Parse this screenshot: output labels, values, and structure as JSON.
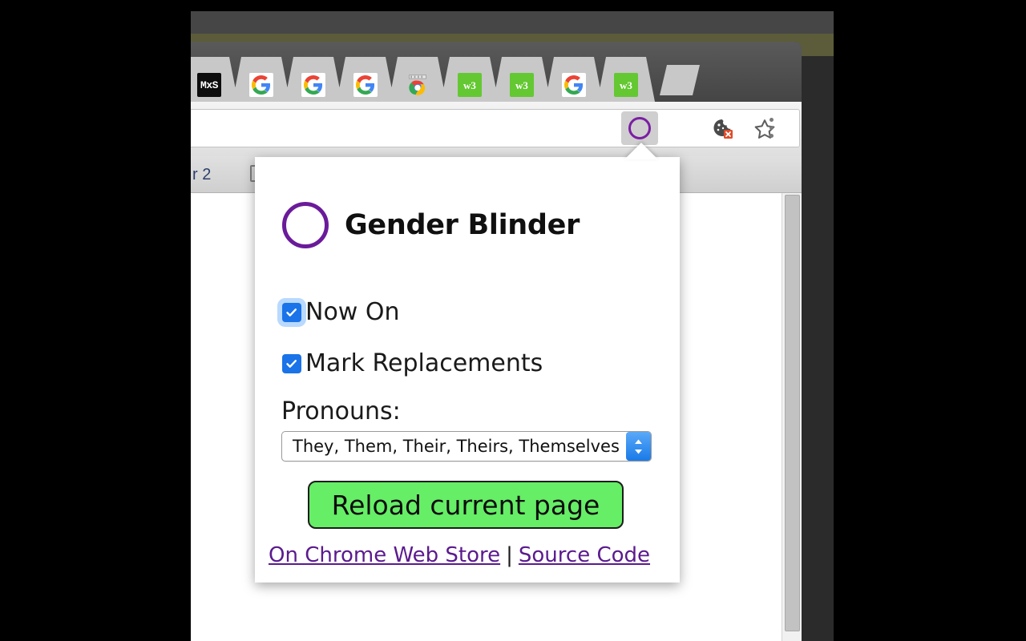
{
  "window": {
    "browser": "Chrome",
    "tabs": [
      {
        "favicon": "mxs-favicon",
        "label": "MxS"
      },
      {
        "favicon": "google-favicon",
        "label": "G"
      },
      {
        "favicon": "google-favicon",
        "label": "G"
      },
      {
        "favicon": "google-favicon",
        "label": "G"
      },
      {
        "favicon": "chrome-web-store-favicon",
        "label": ""
      },
      {
        "favicon": "w3schools-favicon",
        "label": "w3"
      },
      {
        "favicon": "w3schools-favicon",
        "label": "w3"
      },
      {
        "favicon": "google-favicon",
        "label": "G"
      },
      {
        "favicon": "w3schools-favicon",
        "label": "w3"
      }
    ],
    "new_tab_button": "new-tab-button"
  },
  "toolbar": {
    "cookie_blocked_icon": "cookie-blocked-icon",
    "bookmark_star_icon": "star-icon",
    "extension_icon": "gender-blinder-extension-icon",
    "drive_icon": "google-drive-icon",
    "menu_icon": "three-dot-menu-icon"
  },
  "bookmark_bar": {
    "visible_text": "r 2",
    "folder_icon": "folder-icon"
  },
  "popup": {
    "logo_icon": "purple-circle-logo",
    "title": "Gender Blinder",
    "checkboxes": [
      {
        "label": "Now On",
        "checked": true,
        "focused": true
      },
      {
        "label": "Mark Replacements",
        "checked": true,
        "focused": false
      }
    ],
    "pronouns_label": "Pronouns:",
    "pronouns_selected": "They, Them, Their, Theirs, Themselves",
    "reload_button": "Reload current page",
    "links": [
      {
        "text": "On Chrome Web Store "
      },
      {
        "text": "Source Code"
      }
    ],
    "link_separator": "|"
  },
  "colors": {
    "accent_purple": "#6A1B9A",
    "link_purple": "#5b1a8e",
    "button_green": "#66ee66",
    "checkbox_blue": "#1a73e8",
    "w3_green": "#64c832"
  }
}
